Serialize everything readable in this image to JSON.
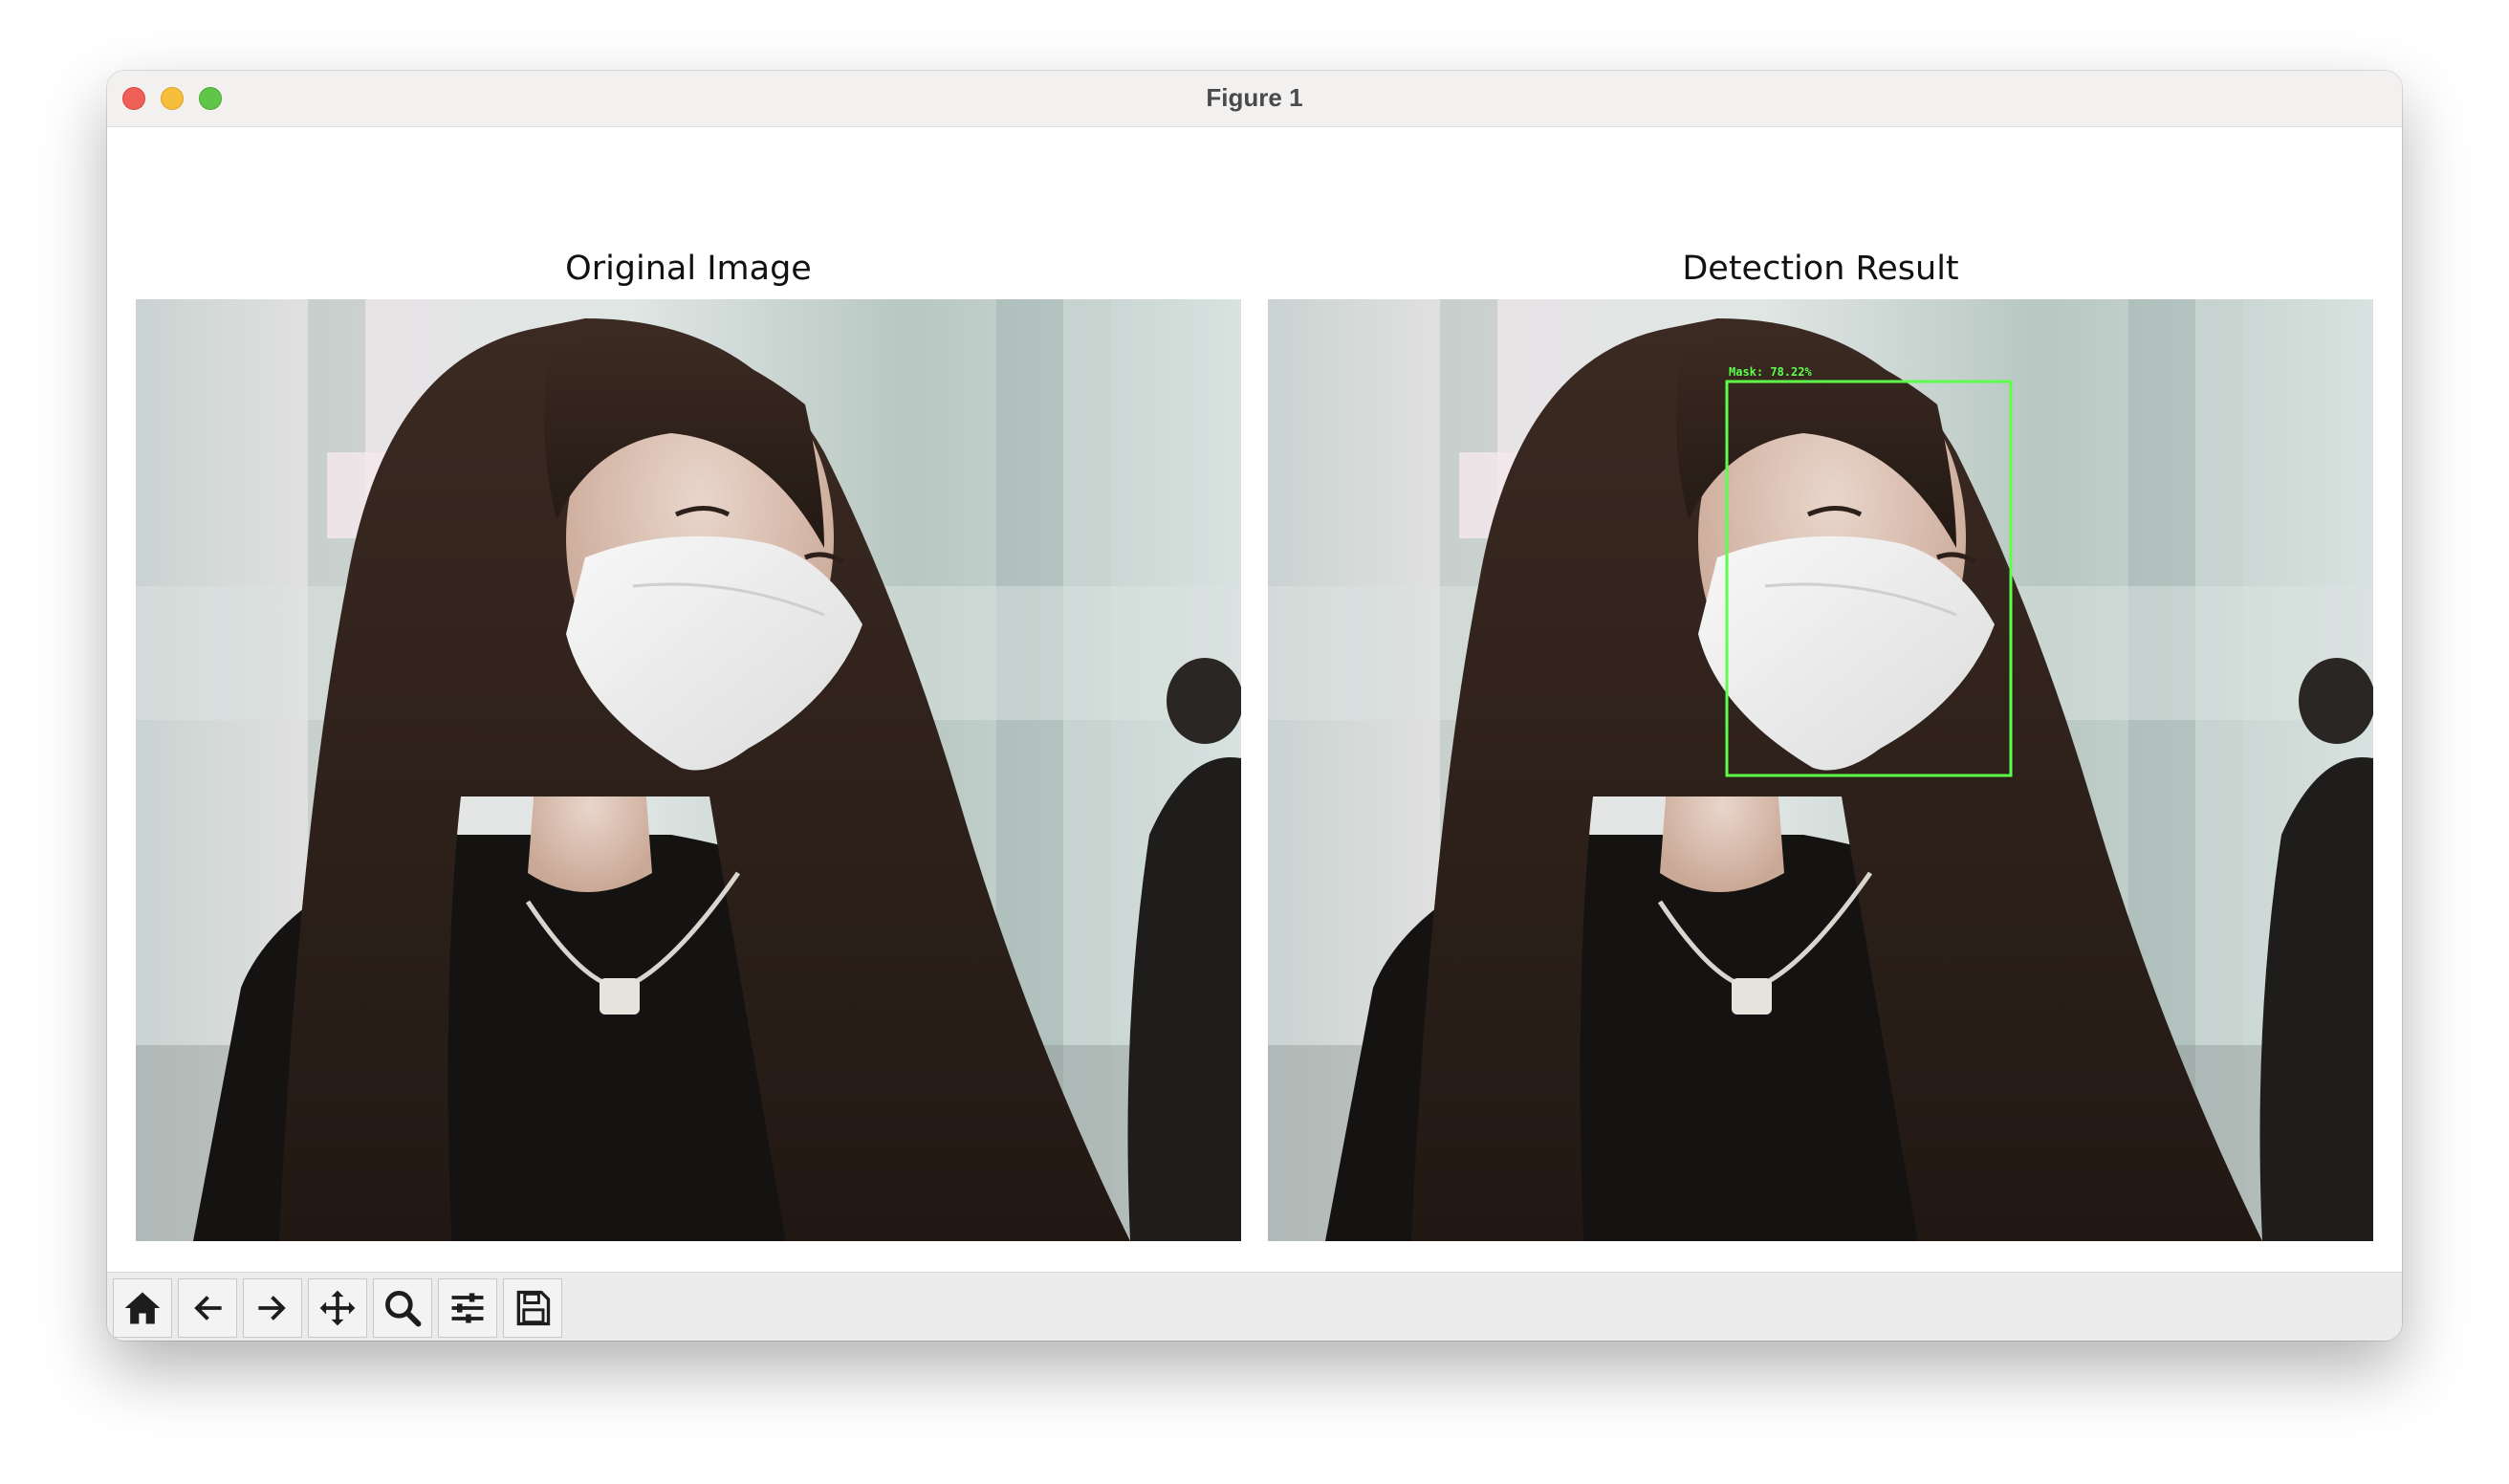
{
  "window": {
    "title": "Figure 1"
  },
  "panels": [
    {
      "title": "Original Image"
    },
    {
      "title": "Detection Result",
      "detection_label": "Mask: 78.22%",
      "box_color": "#5cff4a"
    }
  ],
  "toolbar": {
    "buttons": [
      "home-icon",
      "back-arrow-icon",
      "forward-arrow-icon",
      "pan-move-icon",
      "zoom-magnifier-icon",
      "configure-subplots-icon",
      "save-floppy-icon"
    ]
  },
  "colors": {
    "close": "#ee5f58",
    "minimize": "#f6be3a",
    "maximize": "#5fc64a",
    "detection_box": "#5cff4a"
  }
}
